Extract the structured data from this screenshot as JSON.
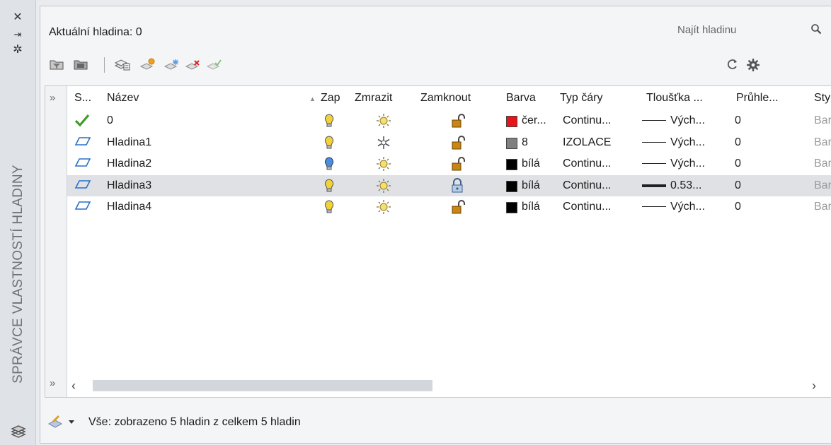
{
  "side_panel": {
    "title": "SPRÁVCE VLASTNOSTÍ HLADINY",
    "close_glyph": "✕",
    "autohide_glyph": "⇥",
    "properties_glyph": "✲"
  },
  "header": {
    "current_layer_label": "Aktuální hladina: 0",
    "search_placeholder": "Najít hladinu"
  },
  "toolbar": {
    "icons": [
      "new-property-filter-icon",
      "new-group-filter-icon",
      "layer-states-manager-icon",
      "new-layer-icon",
      "new-layer-vp-frozen-icon",
      "delete-layer-icon",
      "set-current-icon",
      "refresh-icon",
      "settings-icon"
    ]
  },
  "table": {
    "expand_glyph": "»",
    "columns": [
      "S...",
      "Název",
      "Zap",
      "Zmrazit",
      "Zamknout",
      "Barva",
      "Typ čáry",
      "Tloušťka ...",
      "Průhle...",
      "Styl"
    ],
    "rows": [
      {
        "status": "current",
        "name": "0",
        "on": "on",
        "freeze": "thawed",
        "lock": "unlocked",
        "color_hex": "#e8141a",
        "color": "čer...",
        "linetype": "Continu...",
        "lineweight": "Vých...",
        "lw_style": "thin",
        "transparency": "0",
        "style": "Barv",
        "selected": false
      },
      {
        "status": "layer",
        "name": "Hladina1",
        "on": "on",
        "freeze": "frozen",
        "lock": "unlocked",
        "color_hex": "#808080",
        "color": "8",
        "linetype": "IZOLACE",
        "lineweight": "Vých...",
        "lw_style": "thin",
        "transparency": "0",
        "style": "Barv",
        "selected": false
      },
      {
        "status": "layer",
        "name": "Hladina2",
        "on": "on-blue",
        "freeze": "thawed",
        "lock": "unlocked",
        "color_hex": "#000000",
        "color": "bílá",
        "linetype": "Continu...",
        "lineweight": "Vých...",
        "lw_style": "thin",
        "transparency": "0",
        "style": "Barv",
        "selected": false
      },
      {
        "status": "layer",
        "name": "Hladina3",
        "on": "on",
        "freeze": "thawed",
        "lock": "locked",
        "color_hex": "#000000",
        "color": "bílá",
        "linetype": "Continu...",
        "lineweight": "0.53...",
        "lw_style": "thick",
        "transparency": "0",
        "style": "Barv",
        "selected": true
      },
      {
        "status": "layer",
        "name": "Hladina4",
        "on": "on",
        "freeze": "thawed",
        "lock": "unlocked",
        "color_hex": "#000000",
        "color": "bílá",
        "linetype": "Continu...",
        "lineweight": "Vých...",
        "lw_style": "thin",
        "transparency": "0",
        "style": "Barv",
        "selected": false
      }
    ],
    "scroll_left_glyph": "‹",
    "scroll_right_glyph": "›"
  },
  "status_bar": {
    "text": "Vše: zobrazeno 5 hladin z celkem 5 hladin"
  },
  "colors": {
    "check_green": "#3f9b2b",
    "layer_blue": "#2a6fc9",
    "bulb_yellow": "#f2d23b",
    "lock_orange": "#c98612",
    "selected_row": "#dfe1e4"
  }
}
